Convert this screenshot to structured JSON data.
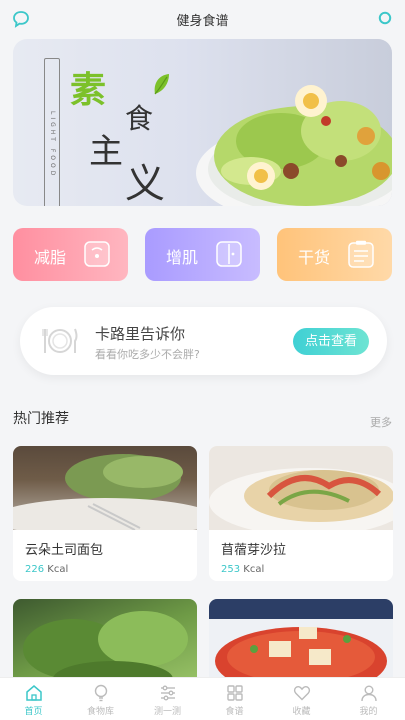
{
  "header": {
    "title": "健身食谱",
    "left_icon": "chat-bubble-icon",
    "right_icon": "circle-icon"
  },
  "banner": {
    "vertical_text": "LIGHT FOOD",
    "char1": "素",
    "char2": "主",
    "char3": "食",
    "char4": "义"
  },
  "categories": [
    {
      "label": "减脂",
      "icon": "scale-icon",
      "color": "#ff8fa0"
    },
    {
      "label": "增肌",
      "icon": "door-icon",
      "color": "#a99bff"
    },
    {
      "label": "干货",
      "icon": "clipboard-icon",
      "color": "#ffc37a"
    }
  ],
  "calorie": {
    "title": "卡路里告诉你",
    "subtitle": "看看你吃多少不会胖?",
    "button": "点击查看"
  },
  "section": {
    "title": "热门推荐",
    "more": "更多"
  },
  "recipes": [
    {
      "name": "云朵土司面包",
      "kcal": "226",
      "unit": "Kcal"
    },
    {
      "name": "苜蓿芽沙拉",
      "kcal": "253",
      "unit": "Kcal"
    },
    {
      "name": "",
      "kcal": "",
      "unit": ""
    },
    {
      "name": "",
      "kcal": "",
      "unit": ""
    }
  ],
  "tabs": [
    {
      "label": "首页",
      "icon": "home-icon",
      "active": true
    },
    {
      "label": "食物库",
      "icon": "bulb-icon",
      "active": false
    },
    {
      "label": "测一测",
      "icon": "sliders-icon",
      "active": false
    },
    {
      "label": "食谱",
      "icon": "grid-icon",
      "active": false
    },
    {
      "label": "收藏",
      "icon": "heart-icon",
      "active": false
    },
    {
      "label": "我的",
      "icon": "user-icon",
      "active": false
    }
  ],
  "colors": {
    "accent": "#3cc7c9",
    "background": "#f4f5f7"
  }
}
